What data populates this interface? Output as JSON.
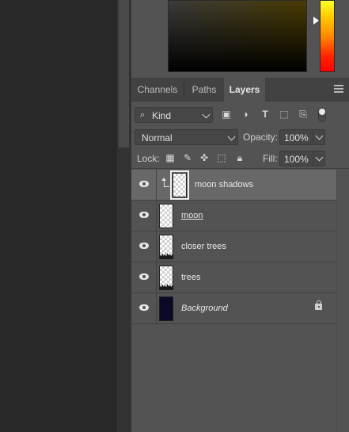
{
  "colors": {
    "panel_bg": "#535353",
    "workspace_bg": "#282828",
    "selected_row": "#686868"
  },
  "tabs": [
    {
      "label": "Channels",
      "active": false
    },
    {
      "label": "Paths",
      "active": false
    },
    {
      "label": "Layers",
      "active": true
    }
  ],
  "filter": {
    "kind_label": "Kind",
    "icons": [
      "image-filter-icon",
      "adjustment-filter-icon",
      "type-filter-icon",
      "shape-filter-icon",
      "smart-object-filter-icon"
    ]
  },
  "blend": {
    "mode": "Normal",
    "opacity_label": "Opacity:",
    "opacity_value": "100%"
  },
  "lock": {
    "label": "Lock:",
    "fill_label": "Fill:",
    "fill_value": "100%",
    "icons": [
      "lock-transparent-pixels-icon",
      "lock-image-pixels-icon",
      "lock-position-icon",
      "lock-artboard-icon",
      "lock-all-icon"
    ]
  },
  "layers": [
    {
      "name": "moon shadows",
      "visible": true,
      "selected": true,
      "clipped": true
    },
    {
      "name": "moon",
      "visible": true,
      "selected": false
    },
    {
      "name": "closer trees",
      "visible": true,
      "selected": false
    },
    {
      "name": "trees",
      "visible": true,
      "selected": false
    },
    {
      "name": "Background",
      "visible": true,
      "selected": false,
      "locked": true
    }
  ]
}
